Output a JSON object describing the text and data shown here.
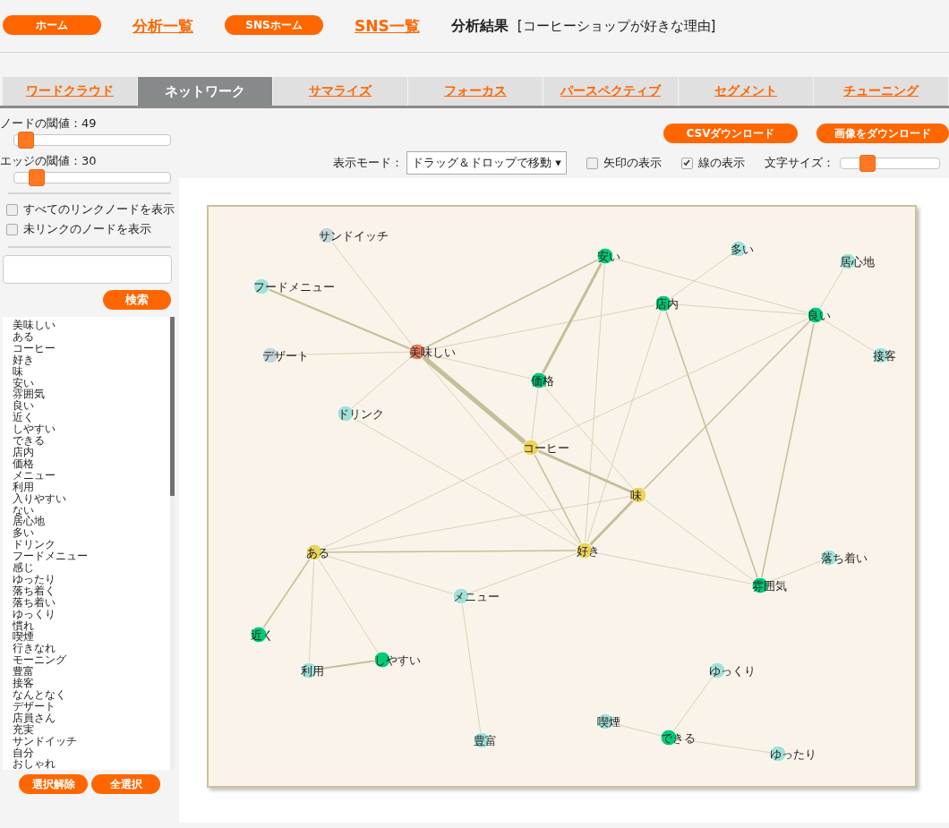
{
  "header": {
    "nav": [
      {
        "kind": "pill",
        "label": "ホーム"
      },
      {
        "kind": "link",
        "label": "分析一覧"
      },
      {
        "kind": "pill",
        "label": "SNSホーム"
      },
      {
        "kind": "link",
        "label": "SNS一覧"
      }
    ],
    "title": "分析結果",
    "subtitle": "[コーヒーショップが好きな理由]"
  },
  "tabs": [
    {
      "label": "ワードクラウド",
      "selected": false
    },
    {
      "label": "ネットワーク",
      "selected": true
    },
    {
      "label": "サマライズ",
      "selected": false
    },
    {
      "label": "フォーカス",
      "selected": false
    },
    {
      "label": "パースペクティブ",
      "selected": false
    },
    {
      "label": "セグメント",
      "selected": false
    },
    {
      "label": "チューニング",
      "selected": false
    }
  ],
  "sidebar": {
    "sliders": [
      {
        "label": "ノードの閾値：49",
        "level": 0.07
      },
      {
        "label": "エッジの閾値：30",
        "level": 0.14
      }
    ],
    "checkboxes": [
      {
        "label": "すべてのリンクノードを表示",
        "checked": false
      },
      {
        "label": "未リンクのノードを表示",
        "checked": false
      }
    ],
    "search_button": "検索",
    "words": [
      "美味しい",
      "ある",
      "コーヒー",
      "好き",
      "味",
      "安い",
      "雰囲気",
      "良い",
      "近く",
      "しやすい",
      "できる",
      "店内",
      "価格",
      "メニュー",
      "利用",
      "入りやすい",
      "ない",
      "居心地",
      "多い",
      "ドリンク",
      "フードメニュー",
      "感じ",
      "ゆったり",
      "落ち着く",
      "落ち着い",
      "ゆっくり",
      "慣れ",
      "喫煙",
      "行きなれ",
      "モーニング",
      "豊富",
      "接客",
      "なんとなく",
      "デザート",
      "店員さん",
      "充実",
      "サンドイッチ",
      "自分",
      "おしゃれ"
    ],
    "buttons": [
      "選択解除",
      "全選択"
    ]
  },
  "toolbar": {
    "buttons": [
      "CSVダウンロード",
      "画像をダウンロード"
    ],
    "mode_label": "表示モード：",
    "mode_value": "ドラッグ＆ドロップで移動 ▾",
    "checkboxes": [
      {
        "label": "矢印の表示",
        "checked": false
      },
      {
        "label": "線の表示",
        "checked": true
      }
    ],
    "font_size": {
      "label": "文字サイズ：",
      "level": 0.27
    }
  },
  "network": {
    "nodes": [
      {
        "label": "サンドイッチ",
        "color": "#c5d7da"
      },
      {
        "label": "フードメニュー",
        "color": "#a3e1d7"
      },
      {
        "label": "デザート",
        "color": "#c5d7da"
      },
      {
        "label": "美味しい",
        "color": "#e8825f"
      },
      {
        "label": "ドリンク",
        "color": "#a3e1d7"
      },
      {
        "label": "安い",
        "color": "#00cc77"
      },
      {
        "label": "多い",
        "color": "#a3e1d7"
      },
      {
        "label": "居心地",
        "color": "#a3e1d7"
      },
      {
        "label": "店内",
        "color": "#00cc77"
      },
      {
        "label": "良い",
        "color": "#00cc77"
      },
      {
        "label": "接客",
        "color": "#a3e1d7"
      },
      {
        "label": "価格",
        "color": "#00cc77"
      },
      {
        "label": "コーヒー",
        "color": "#ecd35a"
      },
      {
        "label": "味",
        "color": "#ecd35a"
      },
      {
        "label": "ある",
        "color": "#ecd35a"
      },
      {
        "label": "好き",
        "color": "#ecd35a"
      },
      {
        "label": "メニュー",
        "color": "#a3e1d7"
      },
      {
        "label": "落ち着い",
        "color": "#a3e1d7"
      },
      {
        "label": "雰囲気",
        "color": "#00cc77"
      },
      {
        "label": "近く",
        "color": "#00cc77"
      },
      {
        "label": "しやすい",
        "color": "#00cc77"
      },
      {
        "label": "利用",
        "color": "#a3e1d7"
      },
      {
        "label": "ゆっくり",
        "color": "#a3e1d7"
      },
      {
        "label": "喫煙",
        "color": "#a3e1d7"
      },
      {
        "label": "できる",
        "color": "#00cc77"
      },
      {
        "label": "ゆったり",
        "color": "#a3e1d7"
      },
      {
        "label": "豊富",
        "color": "#a3e1d7"
      }
    ]
  }
}
